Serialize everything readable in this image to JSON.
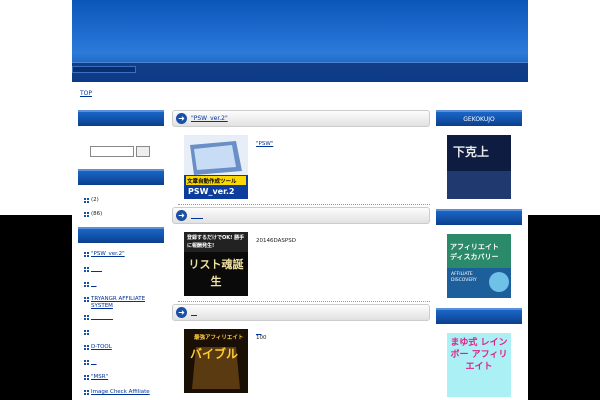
{
  "header": {
    "breadcrumb": "TOP"
  },
  "sidebar_left": {
    "categories": [
      {
        "label": "(2)"
      },
      {
        "label": "(86)"
      }
    ],
    "links": [
      {
        "label": "\"PSW_ver.2\""
      },
      {
        "label": "____"
      },
      {
        "label": "__"
      },
      {
        "label": "TRYANGR AFFILIATE SYSTEM"
      },
      {
        "label": "________"
      },
      {
        "label": ""
      },
      {
        "label": "D-TOOL"
      },
      {
        "label": "__"
      },
      {
        "label": "\"MSR\""
      },
      {
        "label": "Image Check Affiliate"
      }
    ]
  },
  "main": {
    "sections": [
      {
        "title": "\"PSW_ver.2\"",
        "link": "\"PSW\"",
        "text": "",
        "image_text": "PSW_ver.2",
        "image_caption": "文章自動作成ツール"
      },
      {
        "title": "____",
        "link": "",
        "text": "20146DASPSD",
        "image_text": "リスト魂誕生",
        "image_caption": "登録するだけでOK! 勝手に報酬発生!"
      },
      {
        "title": "__",
        "link": "__",
        "text": "100",
        "image_text": "バイブル",
        "image_caption": "最強アフィリエイト"
      }
    ]
  },
  "sidebar_right": {
    "head1": "GEKOKUJO",
    "banner1_text": "下克上",
    "banner2_text": "アフィリエイト ディスカバリー",
    "banner2_sub": "AFFILIATE DISCOVERY",
    "banner3_text": "まゆ式 レインボー アフィリエイト"
  }
}
